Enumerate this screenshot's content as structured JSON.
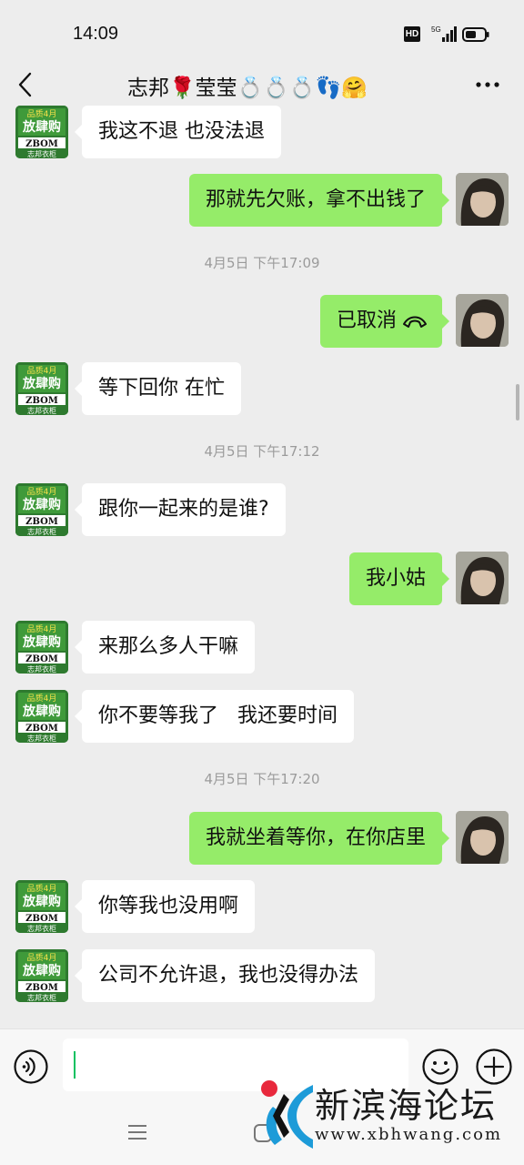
{
  "status_bar": {
    "time": "14:09",
    "hd_label": "HD",
    "network_label": "5G",
    "icons": [
      "hd-icon",
      "signal-icon",
      "battery-icon"
    ]
  },
  "header": {
    "title": "志邦🌹莹莹💍💍💍👣🤗",
    "back_icon": "chevron-left-icon",
    "more_icon": "more-icon"
  },
  "messages": [
    {
      "side": "left",
      "text": "我这不退  也没法退"
    },
    {
      "side": "right",
      "text": "那就先欠账，拿不出钱了"
    },
    {
      "type": "time",
      "text": "4月5日 下午17:09"
    },
    {
      "side": "right",
      "text": "已取消",
      "icon": "phone-hangup-icon"
    },
    {
      "side": "left",
      "text": "等下回你  在忙"
    },
    {
      "type": "time",
      "text": "4月5日 下午17:12"
    },
    {
      "side": "left",
      "text": "跟你一起来的是谁?"
    },
    {
      "side": "right",
      "text": "我小姑"
    },
    {
      "side": "left",
      "text": "来那么多人干嘛"
    },
    {
      "side": "left",
      "text": "你不要等我了   我还要时间"
    },
    {
      "type": "time",
      "text": "4月5日 下午17:20"
    },
    {
      "side": "right",
      "text": "我就坐着等你，在你店里"
    },
    {
      "side": "left",
      "text": "你等我也没用啊"
    },
    {
      "side": "left",
      "text": "公司不允许退，我也没得办法"
    }
  ],
  "left_avatar": {
    "line1": "品质4月",
    "line2": "放肆购",
    "brand": "ZBOM",
    "sub": "志邦衣柜",
    "colors": {
      "bg": "#2e7a2f",
      "accent": "#f5e04a"
    }
  },
  "input_bar": {
    "value": "",
    "voice_icon": "voice-icon",
    "emoji_icon": "emoji-icon",
    "plus_icon": "plus-icon"
  },
  "nav_bar": {
    "icons": [
      "menu-icon",
      "home-icon"
    ]
  },
  "watermark": {
    "text": "新滨海论坛",
    "url": "www.xbhwang.com"
  },
  "colors": {
    "background": "#ededed",
    "bubble_self": "#95ec69",
    "bubble_other": "#ffffff",
    "timestamp": "#9b9b9b",
    "cursor": "#07c160"
  }
}
